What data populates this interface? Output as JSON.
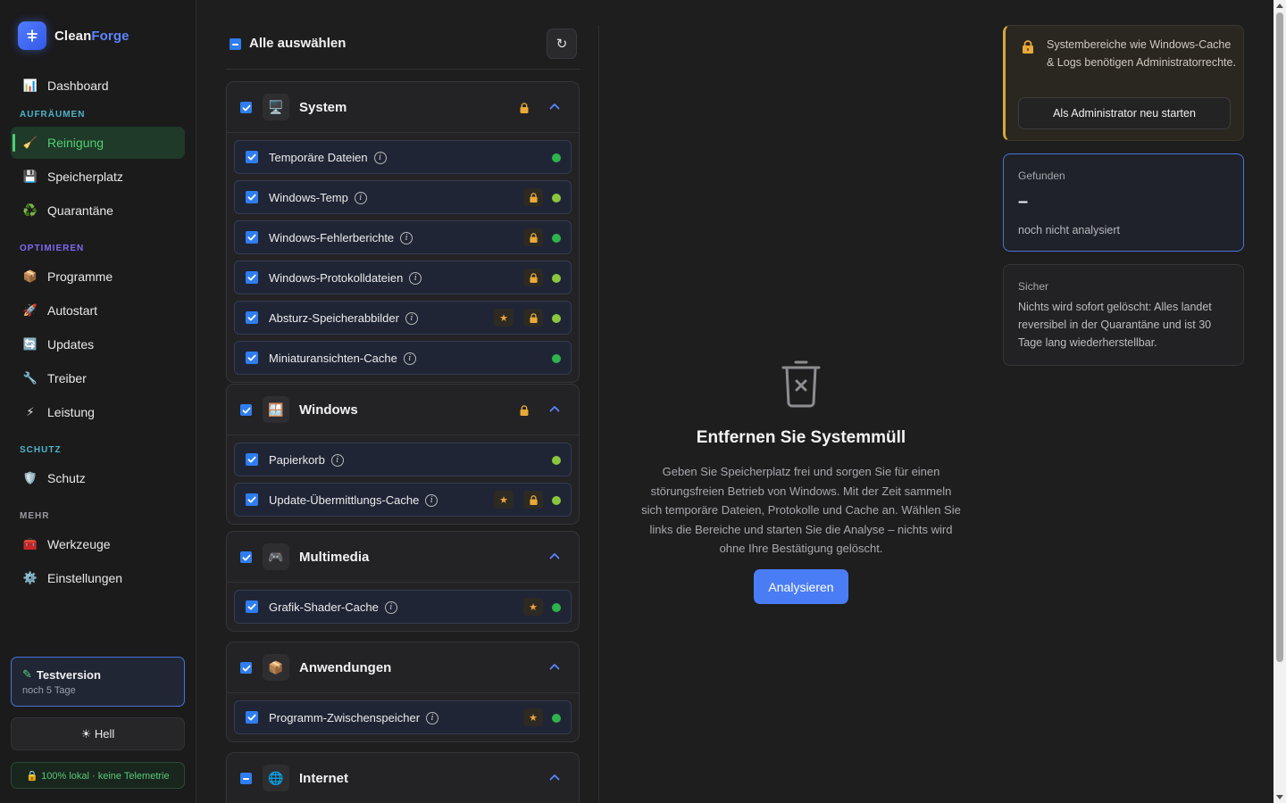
{
  "app": {
    "name_part1": "Clean",
    "name_part2": "Forge"
  },
  "sidebar": {
    "nav": [
      {
        "label": "Dashboard",
        "icon": "chart-icon"
      }
    ],
    "sections": [
      {
        "label": "AUFRÄUMEN",
        "color": "#4fb3c8",
        "items": [
          {
            "label": "Reinigung",
            "icon": "broom-icon",
            "active": true
          },
          {
            "label": "Speicherplatz",
            "icon": "floppy-icon"
          },
          {
            "label": "Quarantäne",
            "icon": "recycle-icon"
          }
        ]
      },
      {
        "label": "OPTIMIEREN",
        "color": "#7b6cf0",
        "items": [
          {
            "label": "Programme",
            "icon": "package-icon"
          },
          {
            "label": "Autostart",
            "icon": "rocket-icon"
          },
          {
            "label": "Updates",
            "icon": "refresh-icon"
          },
          {
            "label": "Treiber",
            "icon": "wrench-icon"
          },
          {
            "label": "Leistung",
            "icon": "lightning-icon"
          }
        ]
      },
      {
        "label": "SCHUTZ",
        "color": "#4fb3c8",
        "items": [
          {
            "label": "Schutz",
            "icon": "shield-icon"
          }
        ]
      },
      {
        "label": "MEHR",
        "color": "#9a9aa0",
        "items": [
          {
            "label": "Werkzeuge",
            "icon": "toolbox-icon"
          },
          {
            "label": "Einstellungen",
            "icon": "gear-icon"
          }
        ]
      }
    ],
    "trial": {
      "title": "Testversion",
      "subtitle": "noch 5 Tage"
    },
    "theme_button": "☀ Hell",
    "local_badge": "🔒 100% lokal · keine Telemetrie"
  },
  "categories": {
    "select_all_label": "Alle auswählen",
    "groups": [
      {
        "title": "System",
        "icon": "monitor-icon",
        "locked": true,
        "checked": "checked",
        "items": [
          {
            "label": "Temporäre Dateien",
            "star": false,
            "lock": false,
            "dot": "#2fb34d"
          },
          {
            "label": "Windows-Temp",
            "star": false,
            "lock": true,
            "dot": "#8bc53f"
          },
          {
            "label": "Windows-Fehlerberichte",
            "star": false,
            "lock": true,
            "dot": "#2fb34d"
          },
          {
            "label": "Windows-Protokolldateien",
            "star": false,
            "lock": true,
            "dot": "#8bc53f"
          },
          {
            "label": "Absturz-Speicherabbilder",
            "star": true,
            "lock": true,
            "dot": "#8bc53f"
          },
          {
            "label": "Miniaturansichten-Cache",
            "star": false,
            "lock": false,
            "dot": "#2fb34d"
          }
        ]
      },
      {
        "title": "Windows",
        "icon": "window-icon",
        "locked": true,
        "checked": "checked",
        "items": [
          {
            "label": "Papierkorb",
            "star": false,
            "lock": false,
            "dot": "#8bc53f"
          },
          {
            "label": "Update-Übermittlungs-Cache",
            "star": true,
            "lock": true,
            "dot": "#8bc53f"
          }
        ]
      },
      {
        "title": "Multimedia",
        "icon": "gamepad-icon",
        "locked": false,
        "checked": "checked",
        "items": [
          {
            "label": "Grafik-Shader-Cache",
            "star": true,
            "lock": false,
            "dot": "#2fb34d"
          }
        ]
      },
      {
        "title": "Anwendungen",
        "icon": "box-icon",
        "locked": false,
        "checked": "checked",
        "items": [
          {
            "label": "Programm-Zwischenspeicher",
            "star": true,
            "lock": false,
            "dot": "#2fb34d"
          }
        ]
      },
      {
        "title": "Internet",
        "icon": "globe-icon",
        "locked": false,
        "checked": "indeterminate",
        "items": []
      }
    ]
  },
  "empty_state": {
    "title": "Entfernen Sie Systemmüll",
    "text": "Geben Sie Speicherplatz frei und sorgen Sie für einen störungsfreien Betrieb von Windows. Mit der Zeit sammeln sich temporäre Dateien, Protokolle und Cache an. Wählen Sie links die Bereiche und starten Sie die Analyse – nichts wird ohne Ihre Bestätigung gelöscht.",
    "button": "Analysieren"
  },
  "admin_card": {
    "text": "Systembereiche wie Windows-Cache & Logs benötigen Administratorrechte.",
    "button": "Als Administrator neu starten"
  },
  "found_card": {
    "label": "Gefunden",
    "value": "–",
    "subtitle": "noch nicht analysiert"
  },
  "safe_card": {
    "label": "Sicher",
    "text": "Nichts wird sofort gelöscht: Alles landet reversibel in der Quarantäne und ist 30 Tage lang wiederherstellbar."
  },
  "colors": {
    "accent": "#4a7df5",
    "active_green": "#4fcf74",
    "admin_amber": "#d9a53c"
  }
}
